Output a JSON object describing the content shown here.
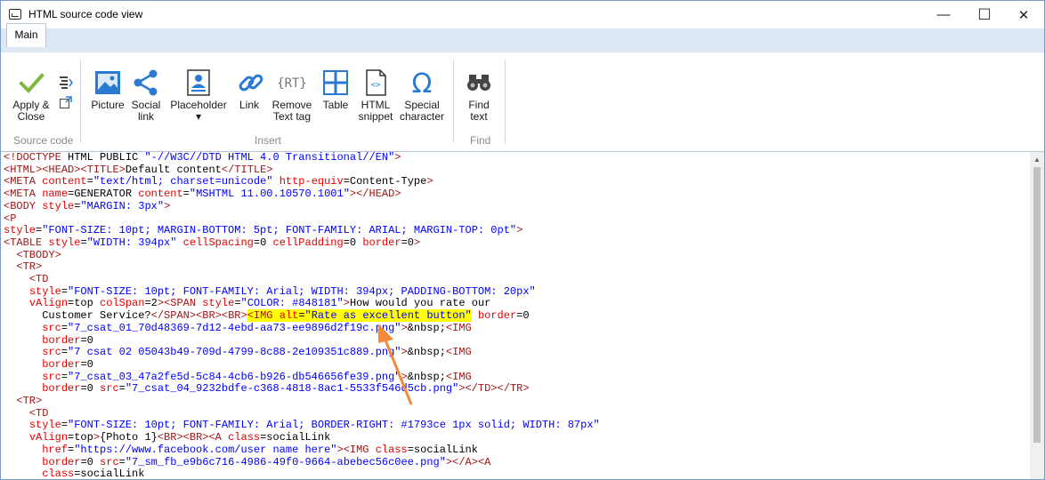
{
  "window": {
    "title": "HTML source code view",
    "controls": {
      "minimize": "—",
      "maximize": "☐",
      "close": "✕"
    }
  },
  "ribbon": {
    "tab": "Main",
    "groups": {
      "source_code": {
        "label": "Source code",
        "apply_close": "Apply &\nClose"
      },
      "insert": {
        "label": "Insert",
        "buttons": [
          {
            "label": "Picture",
            "icon": "picture-icon"
          },
          {
            "label": "Social\nlink",
            "icon": "share-icon"
          },
          {
            "label": "Placeholder\n▾",
            "icon": "placeholder-icon"
          },
          {
            "label": "Link",
            "icon": "link-icon"
          },
          {
            "label": "Remove\nText tag",
            "icon": "remove-text-tag-icon"
          },
          {
            "label": "Table",
            "icon": "table-icon"
          },
          {
            "label": "HTML\nsnippet",
            "icon": "html-snippet-icon"
          },
          {
            "label": "Special\ncharacter",
            "icon": "omega-icon"
          }
        ]
      },
      "find": {
        "label": "Find",
        "find_text": "Find\ntext"
      }
    }
  },
  "code_lines": [
    "<!DOCTYPE HTML PUBLIC \"-//W3C//DTD HTML 4.0 Transitional//EN\">",
    "<HTML><HEAD><TITLE>Default content</TITLE>",
    "<META content=\"text/html; charset=unicode\" http-equiv=Content-Type>",
    "<META name=GENERATOR content=\"MSHTML 11.00.10570.1001\"></HEAD>",
    "<BODY style=\"MARGIN: 3px\">",
    "<P",
    "style=\"FONT-SIZE: 10pt; MARGIN-BOTTOM: 5pt; FONT-FAMILY: ARIAL; MARGIN-TOP: 0pt\">",
    "<TABLE style=\"WIDTH: 394px\" cellSpacing=0 cellPadding=0 border=0>",
    "  <TBODY>",
    "  <TR>",
    "    <TD",
    "    style=\"FONT-SIZE: 10pt; FONT-FAMILY: Arial; WIDTH: 394px; PADDING-BOTTOM: 20px\"",
    "    vAlign=top colSpan=2><SPAN style=\"COLOR: #848181\">How would you rate our",
    "      Customer Service?</SPAN><BR><BR><IMG alt=\"Rate as excellent button\" border=0",
    "      src=\"7_csat_01_70d48369-7d12-4ebd-aa73-ee9896d2f19c.png\">&nbsp;<IMG",
    "      border=0",
    "      src=\"7 csat 02 05043b49-709d-4799-8c88-2e109351c889.png\">&nbsp;<IMG",
    "      border=0",
    "      src=\"7_csat_03_47a2fe5d-5c84-4cb6-b926-db546656fe39.png\">&nbsp;<IMG",
    "      border=0 src=\"7_csat_04_9232bdfe-c368-4818-8ac1-5533f546d5cb.png\"></TD></TR>",
    "  <TR>",
    "    <TD",
    "    style=\"FONT-SIZE: 10pt; FONT-FAMILY: Arial; BORDER-RIGHT: #1793ce 1px solid; WIDTH: 87px\"",
    "    vAlign=top>{Photo 1}<BR><BR><A class=socialLink",
    "      href=\"https://www.facebook.com/user name here\"><IMG class=socialLink",
    "      border=0 src=\"7_sm_fb_e9b6c716-4986-49f0-9664-abebec56c0ee.png\"></A><A",
    "      class=socialLink"
  ],
  "highlight": {
    "line": 13,
    "text": "<IMG alt=\"Rate as excellent button\""
  },
  "colors": {
    "tag": "#a31515",
    "attr": "#e40000",
    "value": "#0000ff",
    "highlight": "#ffff00",
    "arrow": "#f5893a",
    "apply_check": "#7cb83e"
  }
}
